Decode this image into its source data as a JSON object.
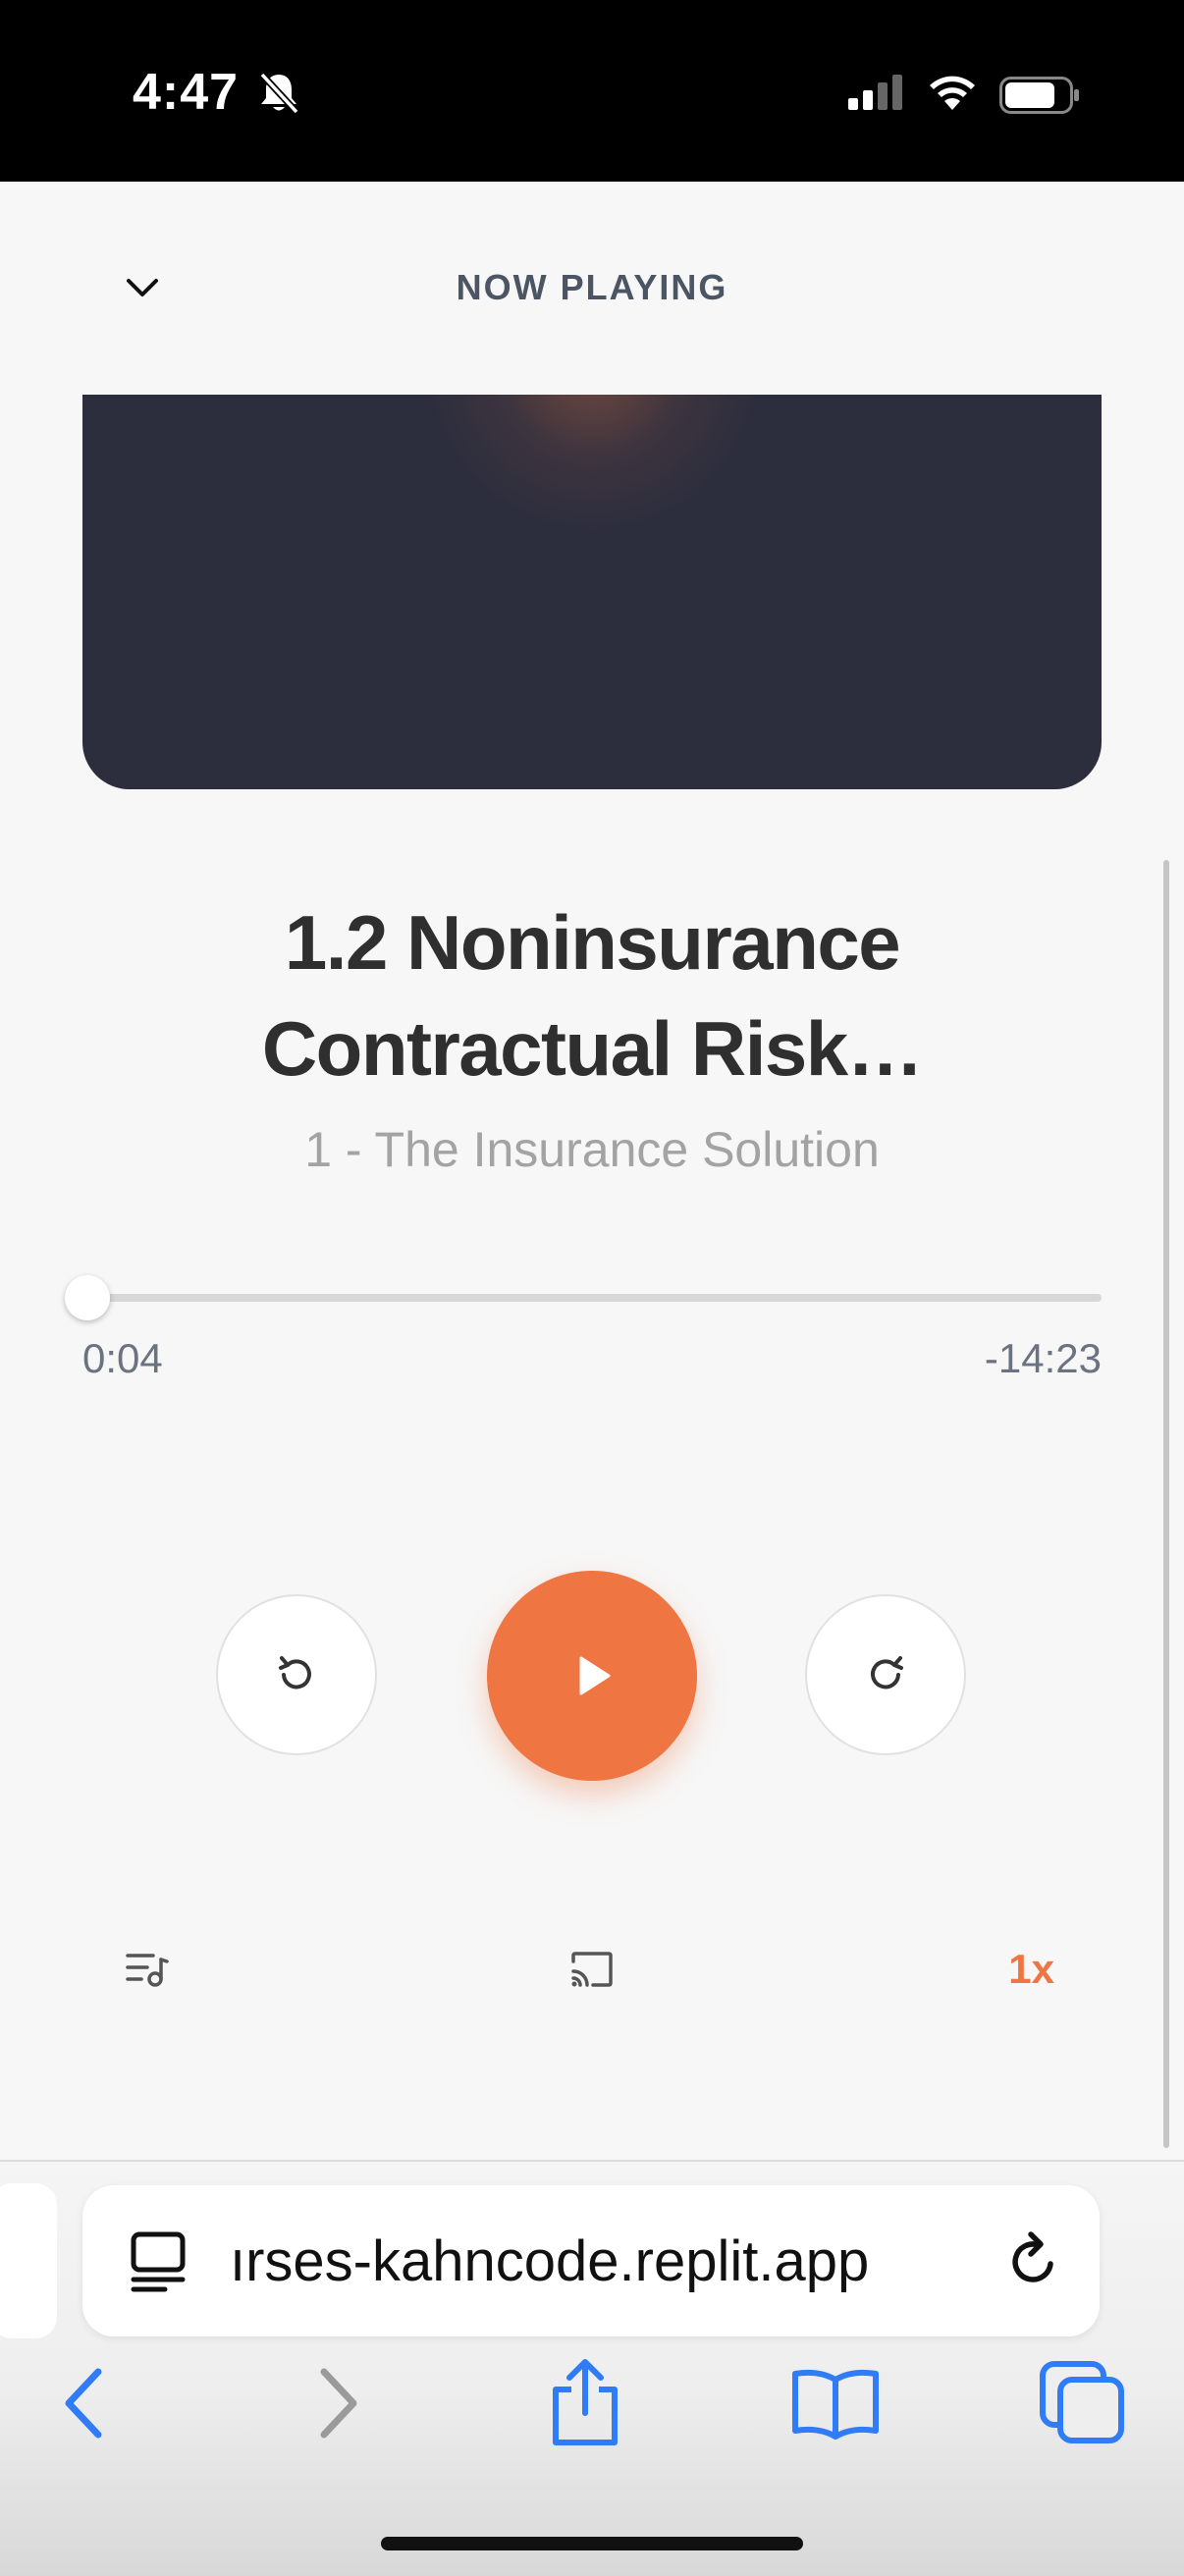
{
  "status_bar": {
    "time": "4:47"
  },
  "player": {
    "header": "NOW PLAYING",
    "title": "1.2 Noninsurance Contractual Risk…",
    "subtitle": "1 - The Insurance Solution",
    "elapsed": "0:04",
    "remaining": "-14:23",
    "progress_fraction": 0.005,
    "speed": "1x",
    "accent_color": "#ef7543"
  },
  "browser": {
    "url": "ırses-kahncode.replit.app"
  },
  "icons": {
    "collapse": "chevron-down-icon",
    "rewind": "rewind-icon",
    "play": "play-icon",
    "forward": "forward-icon",
    "queue": "playlist-icon",
    "cast": "cast-icon",
    "reader": "reader-icon",
    "reload": "reload-icon",
    "back": "back-arrow-icon",
    "forward_nav": "forward-arrow-icon",
    "share": "share-icon",
    "bookmarks": "bookmarks-icon",
    "tabs": "tabs-icon"
  }
}
